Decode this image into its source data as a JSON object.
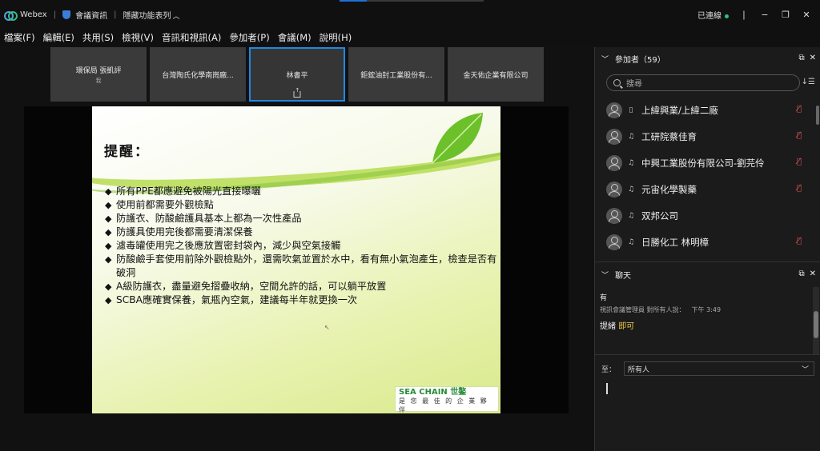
{
  "titlebar": {
    "app_name": "Webex",
    "meeting_info": "會議資訊",
    "hide_menu": "隱藏功能表列",
    "status": "已連線"
  },
  "menu": [
    "檔案(F)",
    "編輯(E)",
    "共用(S)",
    "檢視(V)",
    "音訊和視訊(A)",
    "參加者(P)",
    "會議(M)",
    "說明(H)"
  ],
  "video_tiles": [
    {
      "name": "環保局 張凱評",
      "sub": "我"
    },
    {
      "name": "台灣陶氏化學南崗廠..."
    },
    {
      "name": "林書平"
    },
    {
      "name": "鉅鋐油封工業股份有..."
    },
    {
      "name": "金天佑企業有限公司"
    }
  ],
  "slide": {
    "title": "提醒：",
    "bullets": [
      "所有PPE都應避免被陽光直接曝曬",
      "使用前都需要外觀檢點",
      "防護衣、防酸鹼護具基本上都為一次性產品",
      "防護具使用完後都需要清潔保養",
      "濾毒罐使用完之後應放置密封袋內，減少與空氣接觸",
      "防酸鹼手套使用前除外觀檢點外，還需吹氣並置於水中，看有無小氣泡產生，檢查是否有破洞",
      "A級防護衣，盡量避免摺疊收納，空間允許的話，可以躺平放置",
      "SCBA應確實保養，氣瓶內空氣，建議每半年就更換一次"
    ],
    "seal_brand": "SEA CHAIN 世鏊",
    "seal_tagline": "是 您 最 佳 的 企 業 夥 伴"
  },
  "participants_panel": {
    "title": "參加者（59）",
    "search_placeholder": "搜尋",
    "participants": [
      {
        "name": "上緯興業/上緯二廠",
        "device": "phone",
        "muted": true
      },
      {
        "name": "工研院蔡佳育",
        "device": "audio",
        "muted": true
      },
      {
        "name": "中興工業股份有限公司-劉芫伶",
        "device": "audio",
        "muted": true
      },
      {
        "name": "元宙化學製藥",
        "device": "audio",
        "muted": true
      },
      {
        "name": "双邦公司",
        "device": "audio",
        "muted": false
      },
      {
        "name": "日勝化工 林明樟",
        "device": "audio",
        "muted": true
      }
    ]
  },
  "chat_panel": {
    "title": "聊天",
    "sender": "有",
    "meta": "視訊會議管理員 對所有人說：",
    "time": "下午 3:49",
    "message_a": "提緒",
    "message_b": "即可",
    "to_label": "至：",
    "to_value": "所有人"
  }
}
